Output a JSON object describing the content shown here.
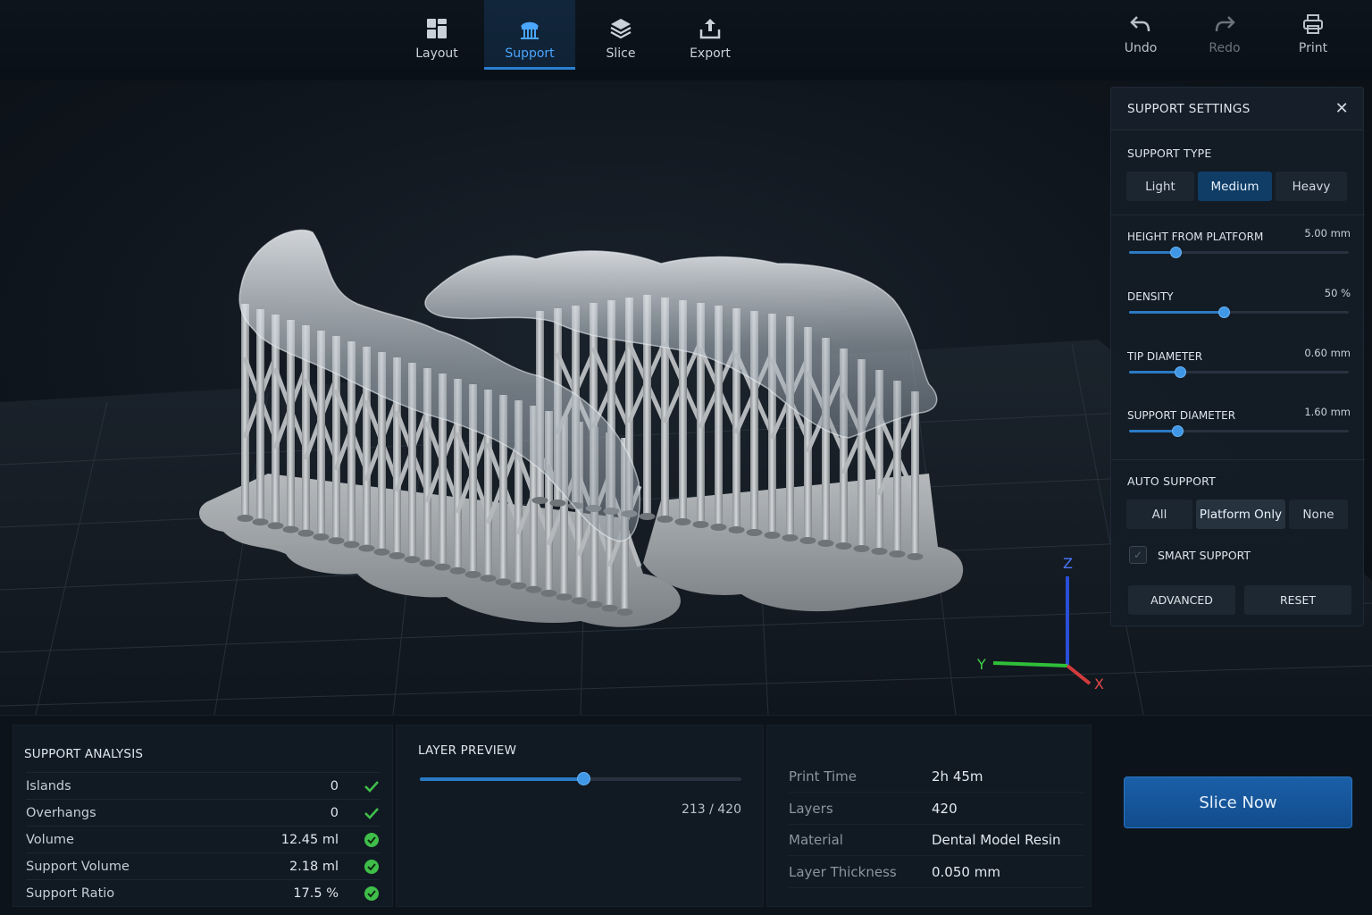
{
  "toolbar": {
    "tabs": [
      {
        "label": "Layout",
        "icon": "layout-icon"
      },
      {
        "label": "Support",
        "icon": "support-icon"
      },
      {
        "label": "Slice",
        "icon": "layers-icon"
      },
      {
        "label": "Export",
        "icon": "export-icon"
      }
    ],
    "active_tab": "Support",
    "actions": {
      "undo": "Undo",
      "redo": "Redo",
      "print": "Print"
    }
  },
  "viewport": {
    "axes": {
      "x": "X",
      "y": "Y",
      "z": "Z"
    }
  },
  "support_settings": {
    "title": "SUPPORT SETTINGS",
    "support_type": {
      "label": "SUPPORT TYPE",
      "options": [
        "Light",
        "Medium",
        "Heavy"
      ],
      "selected": "Medium"
    },
    "sliders": {
      "height": {
        "label": "HEIGHT FROM PLATFORM",
        "value": "5.00 mm",
        "fraction": 0.21
      },
      "density": {
        "label": "DENSITY",
        "value": "50 %",
        "fraction": 0.43
      },
      "tip": {
        "label": "TIP DIAMETER",
        "value": "0.60 mm",
        "fraction": 0.23
      },
      "support_diameter": {
        "label": "SUPPORT DIAMETER",
        "value": "1.60 mm",
        "fraction": 0.22
      }
    },
    "auto_support": {
      "label": "AUTO SUPPORT",
      "options": [
        "All",
        "Platform Only",
        "None"
      ],
      "selected": "Platform Only"
    },
    "smart_support": {
      "label": "SMART SUPPORT",
      "checked": true
    },
    "buttons": {
      "advanced": "ADVANCED",
      "reset": "RESET"
    }
  },
  "analysis": {
    "title": "SUPPORT ANALYSIS",
    "rows": [
      {
        "name": "Islands",
        "value": "0"
      },
      {
        "name": "Overhangs",
        "value": "0"
      },
      {
        "name": "Volume",
        "value": "12.45 ml"
      },
      {
        "name": "Support Volume",
        "value": "2.18 ml"
      },
      {
        "name": "Support Ratio",
        "value": "17.5  %"
      }
    ],
    "status_color": "#3fbf4a"
  },
  "layer_preview": {
    "title": "LAYER PREVIEW",
    "current": 213,
    "total": 420,
    "count_text": "213 / 420"
  },
  "print_info": {
    "rows": [
      {
        "key": "Print Time",
        "value": "2h 45m"
      },
      {
        "key": "Layers",
        "value": "420"
      },
      {
        "key": "Material",
        "value": "Dental Model Resin"
      },
      {
        "key": "Layer Thickness",
        "value": "0.050 mm"
      }
    ]
  },
  "slice_button": "Slice Now",
  "colors": {
    "accent": "#2b7ac4",
    "active_tab": "#4aa6ff",
    "success": "#3fbf4a",
    "axis_x": "#d23b3b",
    "axis_y": "#2fbf3a",
    "axis_z": "#2a4fd8"
  }
}
